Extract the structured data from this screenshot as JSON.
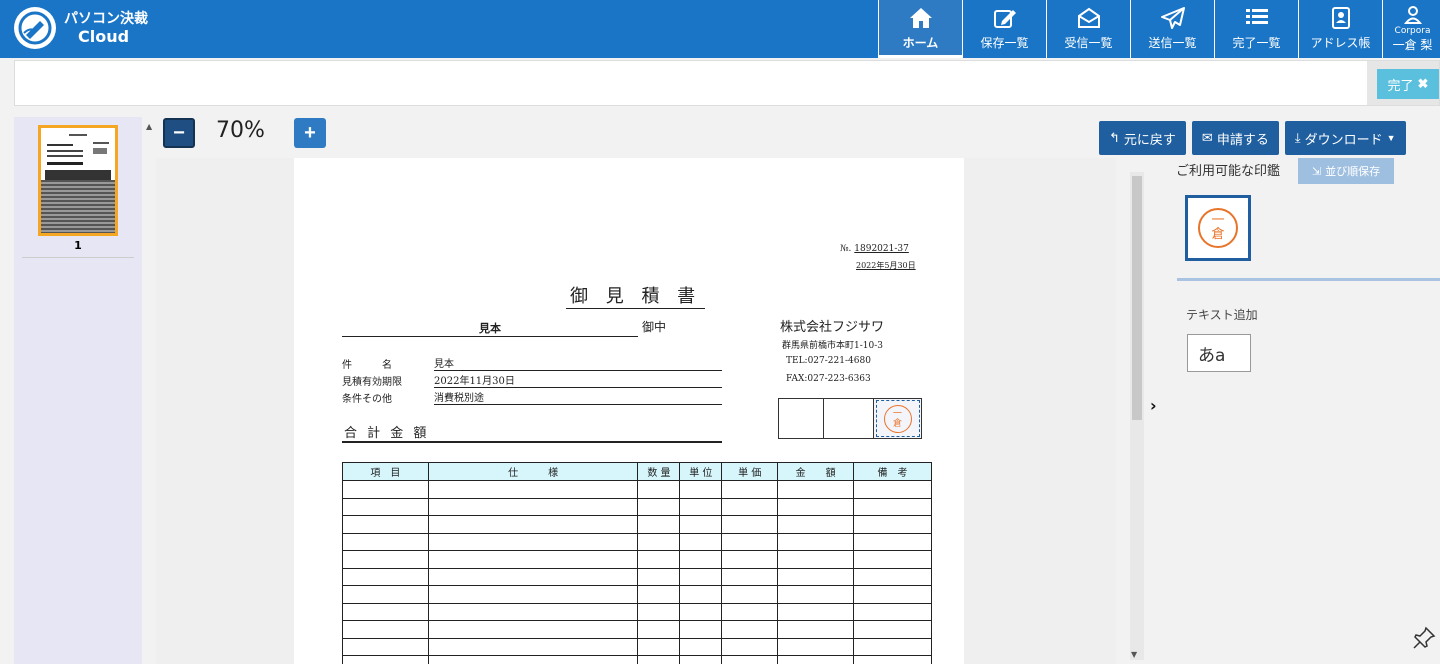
{
  "app": {
    "logo_line1": "パソコン決裁",
    "logo_line2": "Cloud"
  },
  "nav": [
    {
      "label": "ホーム",
      "icon": "home-icon",
      "active": true
    },
    {
      "label": "保存一覧",
      "icon": "edit-icon"
    },
    {
      "label": "受信一覧",
      "icon": "envelope-open-icon"
    },
    {
      "label": "送信一覧",
      "icon": "paper-plane-icon"
    },
    {
      "label": "完了一覧",
      "icon": "list-icon"
    },
    {
      "label": "アドレス帳",
      "icon": "address-book-icon"
    }
  ],
  "user": {
    "company": "Corpora",
    "name": "一倉 梨"
  },
  "subbar": {
    "done_label": "完了"
  },
  "thumbnails": {
    "page_number": "1"
  },
  "zoom": {
    "value": "70%"
  },
  "toolbar": {
    "undo_label": "元に戻す",
    "apply_label": "申請する",
    "download_label": "ダウンロード"
  },
  "document": {
    "no_label": "№.",
    "no_value": "1892021-37",
    "date": "2022年5月30日",
    "title": "御 見 積 書",
    "recipient": "見本",
    "recipient_suffix": "御中",
    "company": "株式会社フジサワ",
    "address": "群馬県前橋市本町1-10-3",
    "tel": "TEL:027-221-4680",
    "fax": "FAX:027-223-6363",
    "fields": [
      {
        "label": "件　　　名",
        "value": "見本"
      },
      {
        "label": "見積有効期限",
        "value": "2022年11月30日"
      },
      {
        "label": "条件その他",
        "value": "消費税別途"
      }
    ],
    "total_label": "合 計 金 額",
    "table_headers": [
      "項　目",
      "仕　　　様",
      "数 量",
      "単 位",
      "単 価",
      "金　　額",
      "備　考"
    ],
    "stamp_char_top": "一",
    "stamp_char_bottom": "倉"
  },
  "panel": {
    "stamps_title": "ご利用可能な印鑑",
    "order_save_label": "並び順保存",
    "text_add_label": "テキスト追加",
    "text_add_sample": "あa"
  },
  "colors": {
    "header": "#1a75c7",
    "accent": "#1f5fa0",
    "stamp": "#e8742a",
    "table_header": "#d6f6fb"
  }
}
